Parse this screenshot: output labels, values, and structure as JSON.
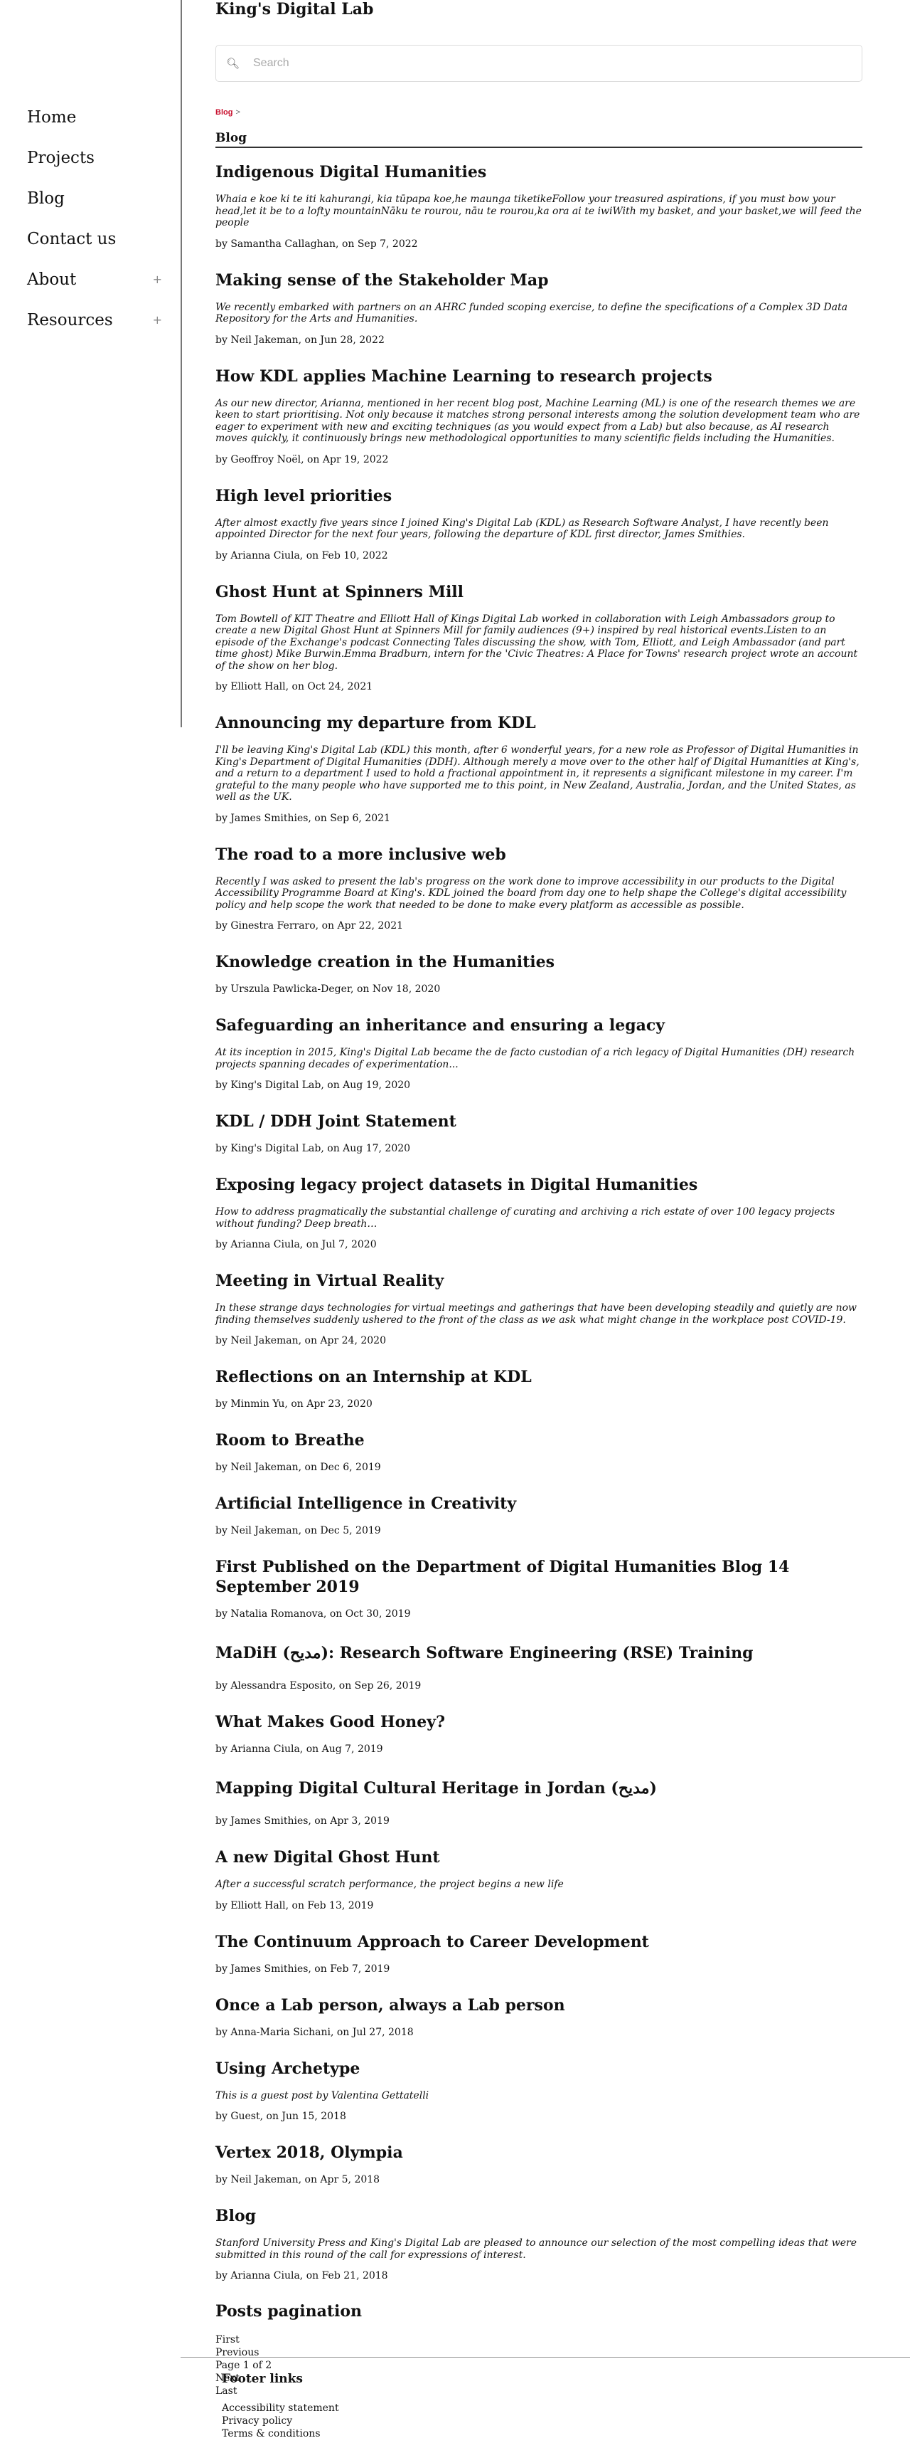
{
  "site": {
    "title": "King's Digital Lab"
  },
  "sidebar": {
    "items": [
      {
        "label": "Home",
        "expandable": false
      },
      {
        "label": "Projects",
        "expandable": false
      },
      {
        "label": "Blog",
        "expandable": false
      },
      {
        "label": "Contact us",
        "expandable": false
      },
      {
        "label": "About",
        "expandable": true,
        "toggle": "+"
      },
      {
        "label": "Resources",
        "expandable": true,
        "toggle": "+"
      }
    ]
  },
  "search": {
    "placeholder": "Search",
    "icon": "search-icon"
  },
  "breadcrumb": {
    "link": "Blog",
    "separator": ">"
  },
  "page": {
    "title": "Blog"
  },
  "posts": [
    {
      "title": "Indigenous Digital Humanities",
      "excerpt": "Whaia e koe ki te iti kahurangi, kia tūpapa koe,he maunga tiketikeFollow your treasured aspirations, if you must bow your head,let it be to a lofty mountainNāku te rourou, nāu te rourou,ka ora ai te iwiWith my basket, and your basket,we will feed the people",
      "byline": "by Samantha Callaghan, on Sep 7, 2022"
    },
    {
      "title": "Making sense of the Stakeholder Map",
      "excerpt": "We recently embarked with partners on an AHRC funded scoping exercise, to define the specifications of a Complex 3D Data Repository for the Arts and Humanities.",
      "byline": "by Neil Jakeman, on Jun 28, 2022"
    },
    {
      "title": "How KDL applies Machine Learning to research projects",
      "excerpt": "As our new director, Arianna, mentioned in her recent blog post, Machine Learning (ML) is one of the research themes we are keen to start prioritising. Not only because it matches strong personal interests among the solution development team who are eager to experiment with new and exciting techniques (as you would expect from a Lab) but also because, as AI research moves quickly, it continuously brings new methodological opportunities to many scientific fields including the Humanities.",
      "byline": "by Geoffroy Noël, on Apr 19, 2022"
    },
    {
      "title": "High level priorities",
      "excerpt": "After almost exactly five years since I joined King's Digital Lab (KDL) as Research Software Analyst, I have recently been appointed Director for the next four years, following the departure of KDL first director, James Smithies.",
      "byline": "by Arianna Ciula, on Feb 10, 2022"
    },
    {
      "title": "Ghost Hunt at Spinners Mill",
      "excerpt": "Tom Bowtell of KIT Theatre and Elliott Hall of Kings Digital Lab worked in collaboration with Leigh Ambassadors group to create a new Digital Ghost Hunt at Spinners Mill for family audiences (9+) inspired by real historical events.Listen to an episode of the Exchange's podcast Connecting Tales discussing the show, with Tom, Elliott, and Leigh Ambassador (and part time ghost) Mike Burwin.Emma Bradburn, intern for the 'Civic Theatres: A Place for Towns' research project wrote an account of the show on her blog.",
      "byline": "by Elliott Hall, on Oct 24, 2021"
    },
    {
      "title": "Announcing my departure from KDL",
      "excerpt": "I'll be leaving King's Digital Lab (KDL) this month, after 6 wonderful years, for a new role as Professor of Digital Humanities in King's Department of Digital Humanities (DDH). Although merely a move over to the other half of Digital Humanities at King's, and a return to a department I used to hold a fractional appointment in, it represents a significant milestone in my career. I'm grateful to the many people who have supported me to this point, in New Zealand, Australia, Jordan, and the United States, as well as the UK.",
      "byline": "by James Smithies, on Sep 6, 2021"
    },
    {
      "title": "The road to a more inclusive web",
      "excerpt": "Recently I was asked to present the lab's progress on the work done to improve accessibility in our products to the Digital Accessibility Programme Board at King's. KDL joined the board from day one to help shape the College's digital accessibility policy and help scope the work that needed to be done to make every platform as accessible as possible.",
      "byline": "by Ginestra Ferraro, on Apr 22, 2021"
    },
    {
      "title": "Knowledge creation in the Humanities",
      "excerpt": "",
      "byline": "by Urszula Pawlicka-Deger, on Nov 18, 2020"
    },
    {
      "title": "Safeguarding an inheritance and ensuring a legacy",
      "excerpt": "At its inception in 2015, King's Digital Lab became the de facto custodian of a rich legacy of Digital Humanities (DH) research projects spanning decades of experimentation...",
      "byline": "by King's Digital Lab, on Aug 19, 2020"
    },
    {
      "title": "KDL / DDH Joint Statement",
      "excerpt": "",
      "byline": "by King's Digital Lab, on Aug 17, 2020"
    },
    {
      "title": "Exposing legacy project datasets in Digital Humanities",
      "excerpt": "How to address pragmatically the substantial challenge of curating and archiving a rich estate of over 100 legacy projects without funding? Deep breath…",
      "byline": "by Arianna Ciula, on Jul 7, 2020"
    },
    {
      "title": "Meeting in Virtual Reality",
      "excerpt": "In these strange days technologies for virtual meetings and gatherings that have been developing steadily and quietly are now finding themselves suddenly ushered to the front of the class as we ask what might change in the workplace post COVID-19.",
      "byline": "by Neil Jakeman, on Apr 24, 2020"
    },
    {
      "title": "Reflections on an Internship at KDL",
      "excerpt": "",
      "byline": "by Minmin Yu, on Apr 23, 2020"
    },
    {
      "title": "Room to Breathe",
      "excerpt": "",
      "byline": "by Neil Jakeman, on Dec 6, 2019"
    },
    {
      "title": "Artificial Intelligence in Creativity",
      "excerpt": "",
      "byline": "by Neil Jakeman, on Dec 5, 2019"
    },
    {
      "title": "First Published on the Department of Digital Humanities Blog 14 September 2019",
      "excerpt": "",
      "byline": "by Natalia Romanova, on Oct 30, 2019"
    },
    {
      "title": "MaDiH (مديح): Research Software Engineering (RSE) Training",
      "excerpt": "",
      "byline": "by Alessandra Esposito, on Sep 26, 2019",
      "tall": true
    },
    {
      "title": "What Makes Good Honey?",
      "excerpt": "",
      "byline": "by Arianna Ciula, on Aug 7, 2019"
    },
    {
      "title": "Mapping Digital Cultural Heritage in Jordan (مديح)",
      "excerpt": "",
      "byline": "by James Smithies, on Apr 3, 2019",
      "tall": true
    },
    {
      "title": "A new Digital Ghost Hunt",
      "excerpt": "After a successful scratch performance, the project begins a new life",
      "byline": "by Elliott Hall, on Feb 13, 2019"
    },
    {
      "title": "The Continuum Approach to Career Development",
      "excerpt": "",
      "byline": "by James Smithies, on Feb 7, 2019"
    },
    {
      "title": "Once a Lab person, always a Lab person",
      "excerpt": "",
      "byline": "by Anna-Maria Sichani, on Jul 27, 2018"
    },
    {
      "title": "Using Archetype",
      "excerpt": "This is a guest post by Valentina Gettatelli",
      "byline": "by Guest, on Jun 15, 2018"
    },
    {
      "title": "Vertex 2018, Olympia",
      "excerpt": "",
      "byline": "by Neil Jakeman, on Apr 5, 2018"
    },
    {
      "title": "Blog",
      "excerpt": "Stanford University Press and King's Digital Lab are pleased to announce our selection of the most compelling ideas that were submitted in this round of the call for expressions of interest.",
      "byline": "by Arianna Ciula, on Feb 21, 2018"
    }
  ],
  "pagination": {
    "title": "Posts pagination",
    "first": "First",
    "previous": "Previous",
    "current": "Page 1 of 2",
    "next": "Next",
    "last": "Last"
  },
  "footer": {
    "title": "Footer links",
    "links": [
      "Accessibility statement",
      "Privacy policy",
      "Terms & conditions"
    ]
  }
}
